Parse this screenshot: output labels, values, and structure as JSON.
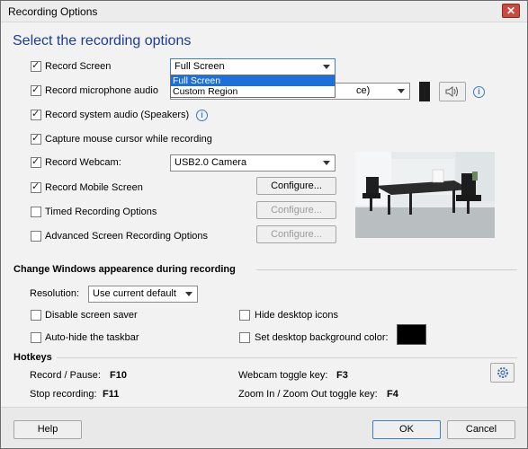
{
  "window": {
    "title": "Recording Options",
    "close_glyph": "✕"
  },
  "heading": "Select the recording options",
  "options": {
    "record_screen": {
      "label": "Record Screen",
      "checked": true,
      "select_value": "Full Screen"
    },
    "record_mic": {
      "label": "Record microphone audio",
      "select_value": "ce)"
    },
    "record_system": {
      "label": "Record system audio (Speakers)"
    },
    "capture_cursor": {
      "label": "Capture mouse cursor while recording"
    },
    "record_webcam": {
      "label": "Record Webcam:",
      "select_value": "USB2.0 Camera"
    },
    "record_mobile": {
      "label": "Record Mobile Screen",
      "button": "Configure..."
    },
    "timed": {
      "label": "Timed Recording Options",
      "button": "Configure..."
    },
    "advanced": {
      "label": "Advanced Screen Recording Options",
      "button": "Configure..."
    }
  },
  "dropdown_items": [
    "Full Screen",
    "Custom Region"
  ],
  "appearance": {
    "title": "Change Windows appearence during recording",
    "resolution_label": "Resolution:",
    "resolution_value": "Use current default",
    "disable_saver": "Disable screen saver",
    "hide_icons": "Hide desktop icons",
    "autohide_taskbar": "Auto-hide the taskbar",
    "set_bg_color": "Set desktop background color:",
    "bg_color": "#000000"
  },
  "hotkeys": {
    "title": "Hotkeys",
    "record_pause_label": "Record / Pause:",
    "record_pause_key": "F10",
    "stop_label": "Stop recording:",
    "stop_key": "F11",
    "webcam_label": "Webcam toggle key:",
    "webcam_key": "F3",
    "zoom_label": "Zoom In / Zoom Out toggle key:",
    "zoom_key": "F4"
  },
  "buttons": {
    "help": "Help",
    "ok": "OK",
    "cancel": "Cancel"
  },
  "icons": {
    "info": "i",
    "speaker": "speaker-icon",
    "gear": "gear-icon"
  },
  "colors": {
    "accent": "#1c3d8f",
    "select_highlight": "#1f6fd8"
  }
}
